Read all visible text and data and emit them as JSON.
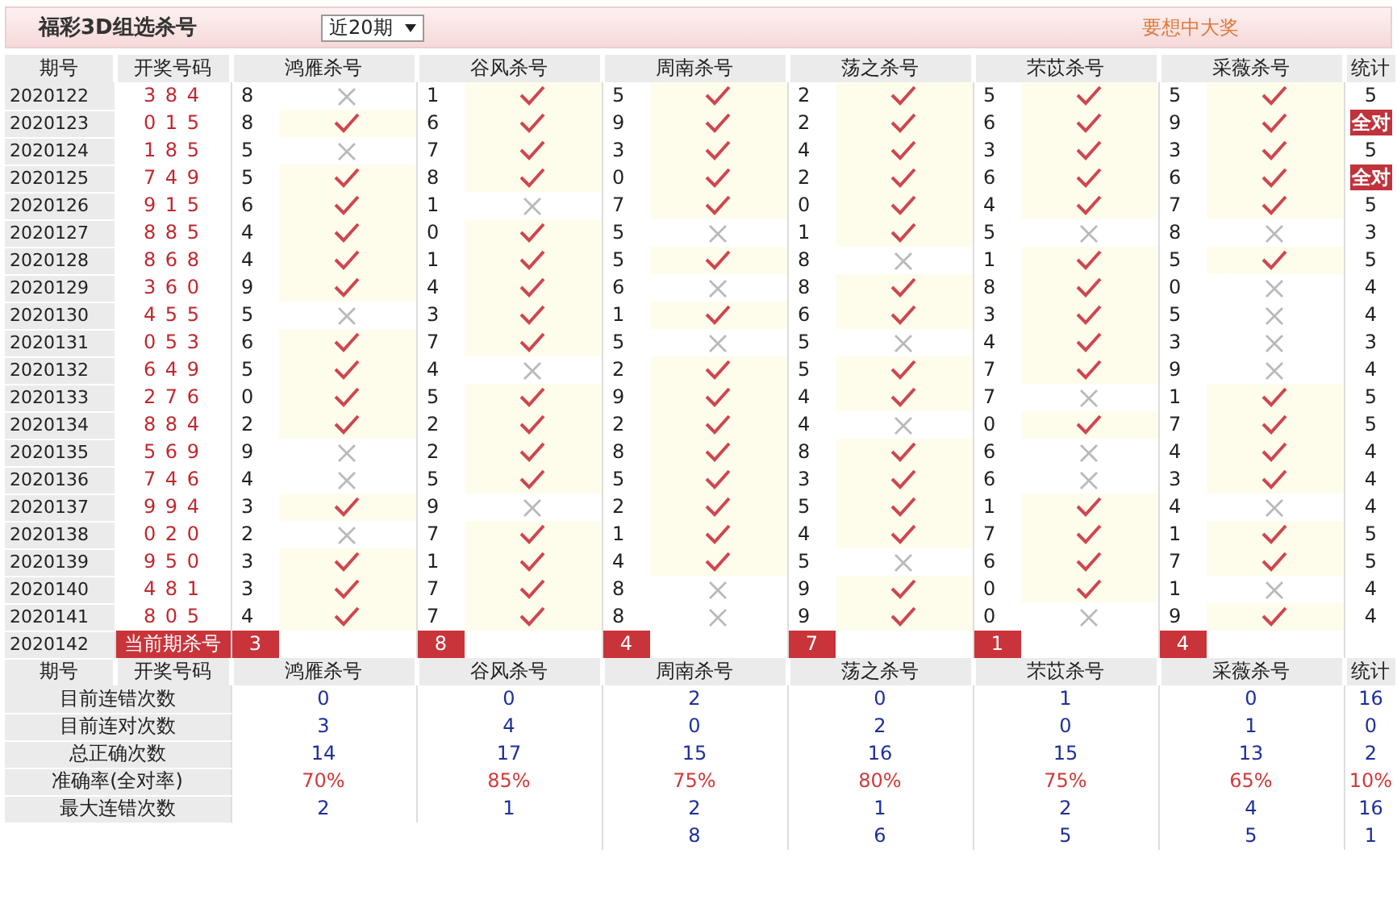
{
  "title": "福彩3D组选杀号",
  "period_select": {
    "value": "近20期"
  },
  "promo": "要想中大奖",
  "columns": [
    "期号",
    "开奖号码",
    "鸿雁杀号",
    "谷风杀号",
    "周南杀号",
    "荡之杀号",
    "芣苡杀号",
    "采薇杀号",
    "统计"
  ],
  "rows": [
    {
      "period": "2020122",
      "draw": "3 8 4",
      "picks": [
        {
          "number": "8",
          "correct": false
        },
        {
          "number": "1",
          "correct": true
        },
        {
          "number": "5",
          "correct": true
        },
        {
          "number": "2",
          "correct": true
        },
        {
          "number": "5",
          "correct": true
        },
        {
          "number": "5",
          "correct": true
        }
      ],
      "stat": {
        "kind": "count",
        "text": "5"
      }
    },
    {
      "period": "2020123",
      "draw": "0 1 5",
      "picks": [
        {
          "number": "8",
          "correct": true
        },
        {
          "number": "6",
          "correct": true
        },
        {
          "number": "9",
          "correct": true
        },
        {
          "number": "2",
          "correct": true
        },
        {
          "number": "6",
          "correct": true
        },
        {
          "number": "9",
          "correct": true
        }
      ],
      "stat": {
        "kind": "badge",
        "text": "全对"
      }
    },
    {
      "period": "2020124",
      "draw": "1 8 5",
      "picks": [
        {
          "number": "5",
          "correct": false
        },
        {
          "number": "7",
          "correct": true
        },
        {
          "number": "3",
          "correct": true
        },
        {
          "number": "4",
          "correct": true
        },
        {
          "number": "3",
          "correct": true
        },
        {
          "number": "3",
          "correct": true
        }
      ],
      "stat": {
        "kind": "count",
        "text": "5"
      }
    },
    {
      "period": "2020125",
      "draw": "7 4 9",
      "picks": [
        {
          "number": "5",
          "correct": true
        },
        {
          "number": "8",
          "correct": true
        },
        {
          "number": "0",
          "correct": true
        },
        {
          "number": "2",
          "correct": true
        },
        {
          "number": "6",
          "correct": true
        },
        {
          "number": "6",
          "correct": true
        }
      ],
      "stat": {
        "kind": "badge",
        "text": "全对"
      }
    },
    {
      "period": "2020126",
      "draw": "9 1 5",
      "picks": [
        {
          "number": "6",
          "correct": true
        },
        {
          "number": "1",
          "correct": false
        },
        {
          "number": "7",
          "correct": true
        },
        {
          "number": "0",
          "correct": true
        },
        {
          "number": "4",
          "correct": true
        },
        {
          "number": "7",
          "correct": true
        }
      ],
      "stat": {
        "kind": "count",
        "text": "5"
      }
    },
    {
      "period": "2020127",
      "draw": "8 8 5",
      "picks": [
        {
          "number": "4",
          "correct": true
        },
        {
          "number": "0",
          "correct": true
        },
        {
          "number": "5",
          "correct": false
        },
        {
          "number": "1",
          "correct": true
        },
        {
          "number": "5",
          "correct": false
        },
        {
          "number": "8",
          "correct": false
        }
      ],
      "stat": {
        "kind": "count",
        "text": "3"
      }
    },
    {
      "period": "2020128",
      "draw": "8 6 8",
      "picks": [
        {
          "number": "4",
          "correct": true
        },
        {
          "number": "1",
          "correct": true
        },
        {
          "number": "5",
          "correct": true
        },
        {
          "number": "8",
          "correct": false
        },
        {
          "number": "1",
          "correct": true
        },
        {
          "number": "5",
          "correct": true
        }
      ],
      "stat": {
        "kind": "count",
        "text": "5"
      }
    },
    {
      "period": "2020129",
      "draw": "3 6 0",
      "picks": [
        {
          "number": "9",
          "correct": true
        },
        {
          "number": "4",
          "correct": true
        },
        {
          "number": "6",
          "correct": false
        },
        {
          "number": "8",
          "correct": true
        },
        {
          "number": "8",
          "correct": true
        },
        {
          "number": "0",
          "correct": false
        }
      ],
      "stat": {
        "kind": "count",
        "text": "4"
      }
    },
    {
      "period": "2020130",
      "draw": "4 5 5",
      "picks": [
        {
          "number": "5",
          "correct": false
        },
        {
          "number": "3",
          "correct": true
        },
        {
          "number": "1",
          "correct": true
        },
        {
          "number": "6",
          "correct": true
        },
        {
          "number": "3",
          "correct": true
        },
        {
          "number": "5",
          "correct": false
        }
      ],
      "stat": {
        "kind": "count",
        "text": "4"
      }
    },
    {
      "period": "2020131",
      "draw": "0 5 3",
      "picks": [
        {
          "number": "6",
          "correct": true
        },
        {
          "number": "7",
          "correct": true
        },
        {
          "number": "5",
          "correct": false
        },
        {
          "number": "5",
          "correct": false
        },
        {
          "number": "4",
          "correct": true
        },
        {
          "number": "3",
          "correct": false
        }
      ],
      "stat": {
        "kind": "count",
        "text": "3"
      }
    },
    {
      "period": "2020132",
      "draw": "6 4 9",
      "picks": [
        {
          "number": "5",
          "correct": true
        },
        {
          "number": "4",
          "correct": false
        },
        {
          "number": "2",
          "correct": true
        },
        {
          "number": "5",
          "correct": true
        },
        {
          "number": "7",
          "correct": true
        },
        {
          "number": "9",
          "correct": false
        }
      ],
      "stat": {
        "kind": "count",
        "text": "4"
      }
    },
    {
      "period": "2020133",
      "draw": "2 7 6",
      "picks": [
        {
          "number": "0",
          "correct": true
        },
        {
          "number": "5",
          "correct": true
        },
        {
          "number": "9",
          "correct": true
        },
        {
          "number": "4",
          "correct": true
        },
        {
          "number": "7",
          "correct": false
        },
        {
          "number": "1",
          "correct": true
        }
      ],
      "stat": {
        "kind": "count",
        "text": "5"
      }
    },
    {
      "period": "2020134",
      "draw": "8 8 4",
      "picks": [
        {
          "number": "2",
          "correct": true
        },
        {
          "number": "2",
          "correct": true
        },
        {
          "number": "2",
          "correct": true
        },
        {
          "number": "4",
          "correct": false
        },
        {
          "number": "0",
          "correct": true
        },
        {
          "number": "7",
          "correct": true
        }
      ],
      "stat": {
        "kind": "count",
        "text": "5"
      }
    },
    {
      "period": "2020135",
      "draw": "5 6 9",
      "picks": [
        {
          "number": "9",
          "correct": false
        },
        {
          "number": "2",
          "correct": true
        },
        {
          "number": "8",
          "correct": true
        },
        {
          "number": "8",
          "correct": true
        },
        {
          "number": "6",
          "correct": false
        },
        {
          "number": "4",
          "correct": true
        }
      ],
      "stat": {
        "kind": "count",
        "text": "4"
      }
    },
    {
      "period": "2020136",
      "draw": "7 4 6",
      "picks": [
        {
          "number": "4",
          "correct": false
        },
        {
          "number": "5",
          "correct": true
        },
        {
          "number": "5",
          "correct": true
        },
        {
          "number": "3",
          "correct": true
        },
        {
          "number": "6",
          "correct": false
        },
        {
          "number": "3",
          "correct": true
        }
      ],
      "stat": {
        "kind": "count",
        "text": "4"
      }
    },
    {
      "period": "2020137",
      "draw": "9 9 4",
      "picks": [
        {
          "number": "3",
          "correct": true
        },
        {
          "number": "9",
          "correct": false
        },
        {
          "number": "2",
          "correct": true
        },
        {
          "number": "5",
          "correct": true
        },
        {
          "number": "1",
          "correct": true
        },
        {
          "number": "4",
          "correct": false
        }
      ],
      "stat": {
        "kind": "count",
        "text": "4"
      }
    },
    {
      "period": "2020138",
      "draw": "0 2 0",
      "picks": [
        {
          "number": "2",
          "correct": false
        },
        {
          "number": "7",
          "correct": true
        },
        {
          "number": "1",
          "correct": true
        },
        {
          "number": "4",
          "correct": true
        },
        {
          "number": "7",
          "correct": true
        },
        {
          "number": "1",
          "correct": true
        }
      ],
      "stat": {
        "kind": "count",
        "text": "5"
      }
    },
    {
      "period": "2020139",
      "draw": "9 5 0",
      "picks": [
        {
          "number": "3",
          "correct": true
        },
        {
          "number": "1",
          "correct": true
        },
        {
          "number": "4",
          "correct": true
        },
        {
          "number": "5",
          "correct": false
        },
        {
          "number": "6",
          "correct": true
        },
        {
          "number": "7",
          "correct": true
        }
      ],
      "stat": {
        "kind": "count",
        "text": "5"
      }
    },
    {
      "period": "2020140",
      "draw": "4 8 1",
      "picks": [
        {
          "number": "3",
          "correct": true
        },
        {
          "number": "7",
          "correct": true
        },
        {
          "number": "8",
          "correct": false
        },
        {
          "number": "9",
          "correct": true
        },
        {
          "number": "0",
          "correct": true
        },
        {
          "number": "1",
          "correct": false
        }
      ],
      "stat": {
        "kind": "count",
        "text": "4"
      }
    },
    {
      "period": "2020141",
      "draw": "8 0 5",
      "picks": [
        {
          "number": "4",
          "correct": true
        },
        {
          "number": "7",
          "correct": true
        },
        {
          "number": "8",
          "correct": false
        },
        {
          "number": "9",
          "correct": true
        },
        {
          "number": "0",
          "correct": false
        },
        {
          "number": "9",
          "correct": true
        }
      ],
      "stat": {
        "kind": "count",
        "text": "4"
      }
    }
  ],
  "current": {
    "period": "2020142",
    "label": "当前期杀号",
    "picks": [
      "3",
      "8",
      "4",
      "7",
      "1",
      "4"
    ]
  },
  "stats_columns": [
    "期号",
    "开奖号码",
    "鸿雁杀号",
    "谷风杀号",
    "周南杀号",
    "荡之杀号",
    "芣苡杀号",
    "采薇杀号",
    "统计"
  ],
  "stats": [
    {
      "label": "目前连错次数",
      "kind": "count",
      "values": [
        "0",
        "0",
        "2",
        "0",
        "1",
        "0",
        "16"
      ]
    },
    {
      "label": "目前连对次数",
      "kind": "count",
      "values": [
        "3",
        "4",
        "0",
        "2",
        "0",
        "1",
        "0"
      ]
    },
    {
      "label": "总正确次数",
      "kind": "count",
      "values": [
        "14",
        "17",
        "15",
        "16",
        "15",
        "13",
        "2"
      ]
    },
    {
      "label": "准确率(全对率)",
      "kind": "rate",
      "values": [
        "70%",
        "85%",
        "75%",
        "80%",
        "75%",
        "65%",
        "10%"
      ]
    },
    {
      "label": "最大连错次数",
      "kind": "count",
      "values": [
        "2",
        "1",
        "2",
        "1",
        "2",
        "4",
        "16"
      ]
    },
    {
      "kind": "count",
      "values": [
        "8",
        "6",
        "5",
        "5",
        "1"
      ]
    }
  ]
}
